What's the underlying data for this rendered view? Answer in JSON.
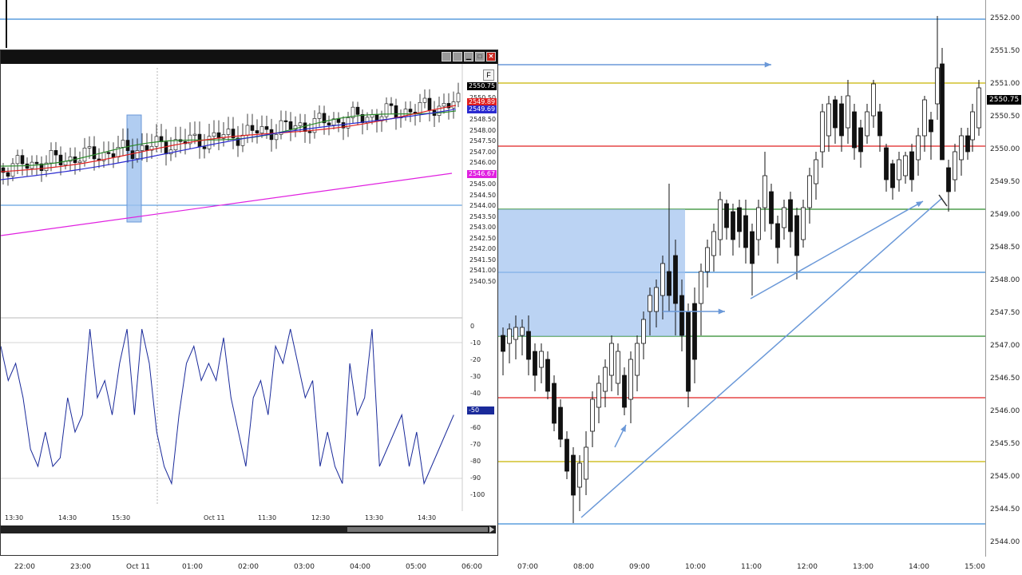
{
  "main_chart": {
    "price_labels": [
      "2552.00",
      "2551.50",
      "2551.00",
      "2550.50",
      "2550.00",
      "2549.50",
      "2549.00",
      "2548.50",
      "2548.00",
      "2547.50",
      "2547.00",
      "2546.50",
      "2546.00",
      "2545.50",
      "2545.00",
      "2544.50",
      "2544.00"
    ],
    "last_price_tag": "2550.75",
    "time_labels": [
      "22:00",
      "23:00",
      "Oct 11",
      "01:00",
      "02:00",
      "03:00",
      "04:00",
      "05:00",
      "06:00",
      "07:00",
      "08:00",
      "09:00",
      "10:00",
      "11:00",
      "12:00",
      "13:00",
      "14:00",
      "15:00"
    ],
    "colors": {
      "blue": "#3a8ad8",
      "yellow": "#c8b400",
      "red": "#e02020",
      "green": "#2a8a2a",
      "zone": "#9ec0ee",
      "arrow": "#6a98d8"
    }
  },
  "sub_window": {
    "title_buttons": [
      "restore-icon",
      "tile-icon",
      "minimize-icon",
      "maximize-icon",
      "close-icon"
    ],
    "close_label": "✕",
    "minimize_label": "▁",
    "maximize_label": "□",
    "panel_button_label": "F",
    "price_labels": [
      "2550.50",
      "2549.00",
      "2548.50",
      "2548.00",
      "2547.50",
      "2547.00",
      "2546.00",
      "2545.50",
      "2545.00",
      "2544.50",
      "2544.00",
      "2543.50",
      "2543.00",
      "2542.50",
      "2542.00",
      "2541.50",
      "2541.00",
      "2540.50"
    ],
    "price_tags": {
      "last": "2550.75",
      "red": "2549.89",
      "blue": "2549.69",
      "magenta": "2546.67"
    },
    "osc_labels": [
      "0",
      "-10",
      "-20",
      "-30",
      "-40",
      "-60",
      "-70",
      "-80",
      "-90",
      "-100"
    ],
    "osc_tag": "-50",
    "time_labels": [
      "13:30",
      "14:30",
      "15:30",
      "Oct 11",
      "11:30",
      "12:30",
      "13:30",
      "14:30"
    ]
  }
}
